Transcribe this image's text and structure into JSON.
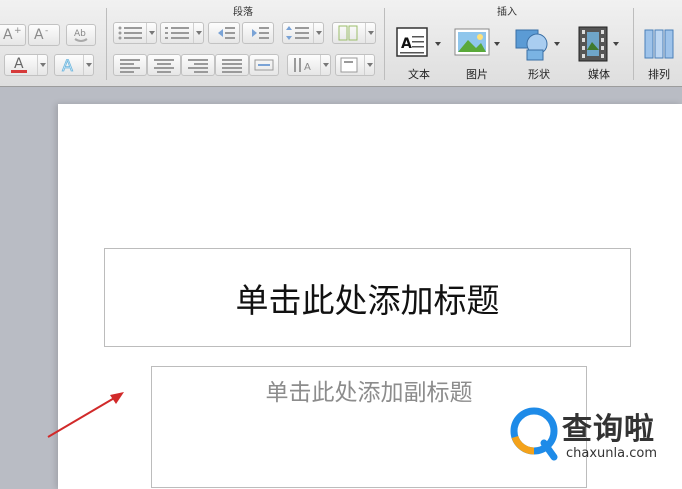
{
  "ribbon": {
    "groups": {
      "paragraph": "段落",
      "insert": "插入"
    },
    "insert_buttons": [
      "文本",
      "图片",
      "形状",
      "媒体",
      "排列"
    ],
    "font_glyphs": {
      "grow": "A",
      "shrink": "A",
      "sup_plus": "+",
      "sup_minus": "-",
      "color": "A"
    }
  },
  "slide": {
    "title_placeholder": "单击此处添加标题",
    "subtitle_placeholder": "单击此处添加副标题"
  },
  "watermark": {
    "cn": "查询啦",
    "en": "chaxunla.com"
  },
  "colors": {
    "arrow": "#d12a2a",
    "watermark_blue": "#1e8be8",
    "watermark_orange": "#f4a21a"
  }
}
